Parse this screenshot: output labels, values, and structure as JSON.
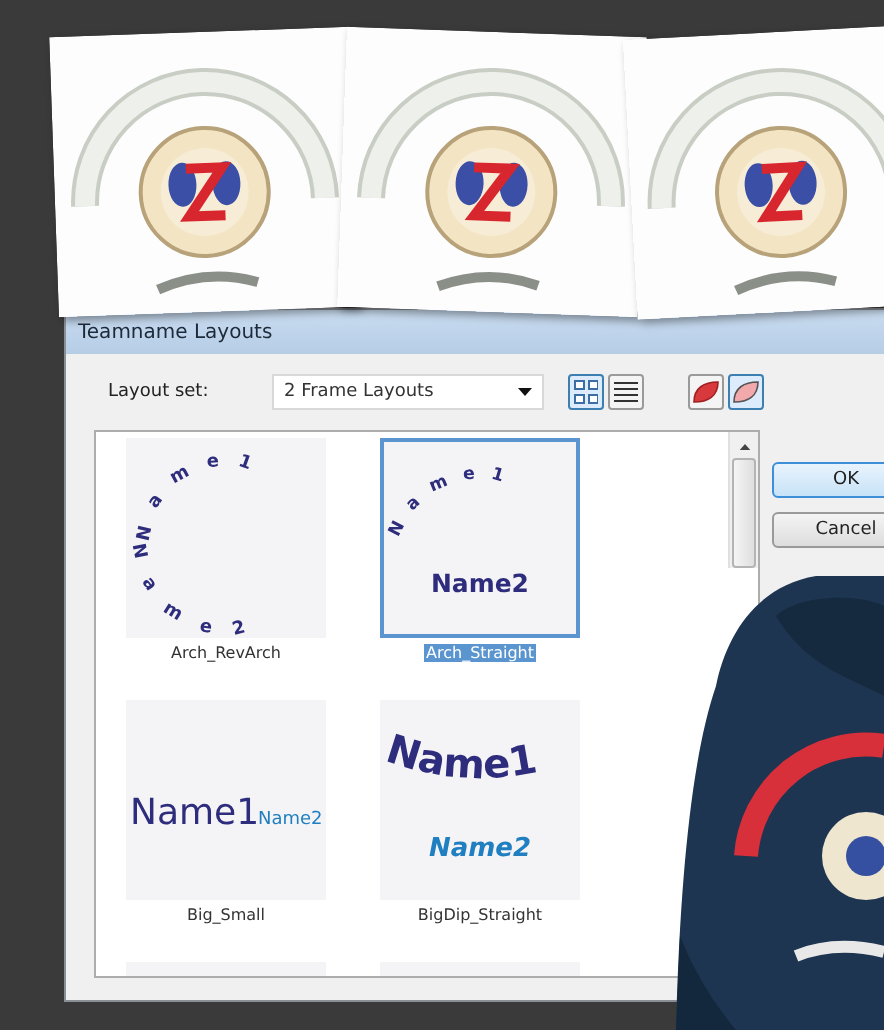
{
  "dialog": {
    "title": "Teamname Layouts",
    "layout_set": {
      "label": "Layout set:",
      "value": "2 Frame Layouts"
    },
    "view_modes": [
      {
        "kind": "grid",
        "selected": true
      },
      {
        "kind": "list",
        "selected": false
      }
    ],
    "fill_modes": [
      {
        "kind": "filled",
        "selected": false
      },
      {
        "kind": "outline",
        "selected": true
      }
    ],
    "layouts": [
      {
        "kind": "arch_revarch",
        "label": "Arch_RevArch",
        "selected": false,
        "lines": [
          "Name1",
          "Name2"
        ]
      },
      {
        "kind": "arch_straight",
        "label": "Arch_Straight",
        "selected": true,
        "lines": [
          "Name1",
          "Name2"
        ]
      },
      {
        "kind": "big_small",
        "label": "Big_Small",
        "selected": false,
        "lines": [
          "Name1",
          "Name2"
        ]
      },
      {
        "kind": "bigdip_straight",
        "label": "BigDip_Straight",
        "selected": false,
        "lines": [
          "Name1",
          "Name2"
        ]
      }
    ],
    "buttons": [
      {
        "label": "OK",
        "default": true
      },
      {
        "label": "Cancel",
        "default": false
      }
    ]
  }
}
